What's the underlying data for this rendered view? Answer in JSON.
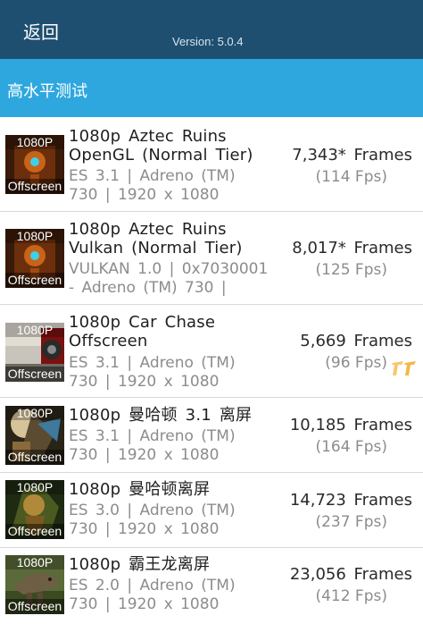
{
  "header": {
    "back_label": "返回",
    "version": "Version: 5.0.4"
  },
  "section": {
    "title": "高水平测试"
  },
  "thumb_labels": {
    "top": "1080P",
    "bottom": "Offscreen"
  },
  "rows": [
    {
      "name": [
        "1080p Aztec Ruins",
        "OpenGL (Normal Tier)"
      ],
      "details": [
        "ES 3.1 | Adreno (TM)",
        "730 | 1920 x 1080"
      ],
      "frames": "7,343* Frames",
      "fps": "(114 Fps)"
    },
    {
      "name": [
        "1080p Aztec Ruins",
        "Vulkan (Normal Tier)"
      ],
      "details": [
        "VULKAN 1.0 | 0x7030001",
        "- Adreno (TM) 730 |"
      ],
      "frames": "8,017* Frames",
      "fps": "(125 Fps)"
    },
    {
      "name": [
        "1080p Car Chase",
        "Offscreen"
      ],
      "details": [
        "ES 3.1 | Adreno (TM)",
        "730 | 1920 x 1080"
      ],
      "frames": "5,669 Frames",
      "fps": "(96 Fps)"
    },
    {
      "name": [
        "1080p 曼哈顿 3.1 离屏"
      ],
      "details": [
        "ES 3.1 | Adreno (TM)",
        "730 | 1920 x 1080"
      ],
      "frames": "10,185 Frames",
      "fps": "(164 Fps)"
    },
    {
      "name": [
        "1080p 曼哈顿离屏"
      ],
      "details": [
        "ES 3.0 | Adreno (TM)",
        "730 | 1920 x 1080"
      ],
      "frames": "14,723 Frames",
      "fps": "(237 Fps)"
    },
    {
      "name": [
        "1080p 霸王龙离屏"
      ],
      "details": [
        "ES 2.0 | Adreno (TM)",
        "730 | 1920 x 1080"
      ],
      "frames": "23,056 Frames",
      "fps": "(412 Fps)"
    }
  ],
  "colors": {
    "topbar": "#1f4f70",
    "section": "#2ea7df",
    "primary_text": "#1f1f1f",
    "secondary_text": "#8c8c8c"
  }
}
